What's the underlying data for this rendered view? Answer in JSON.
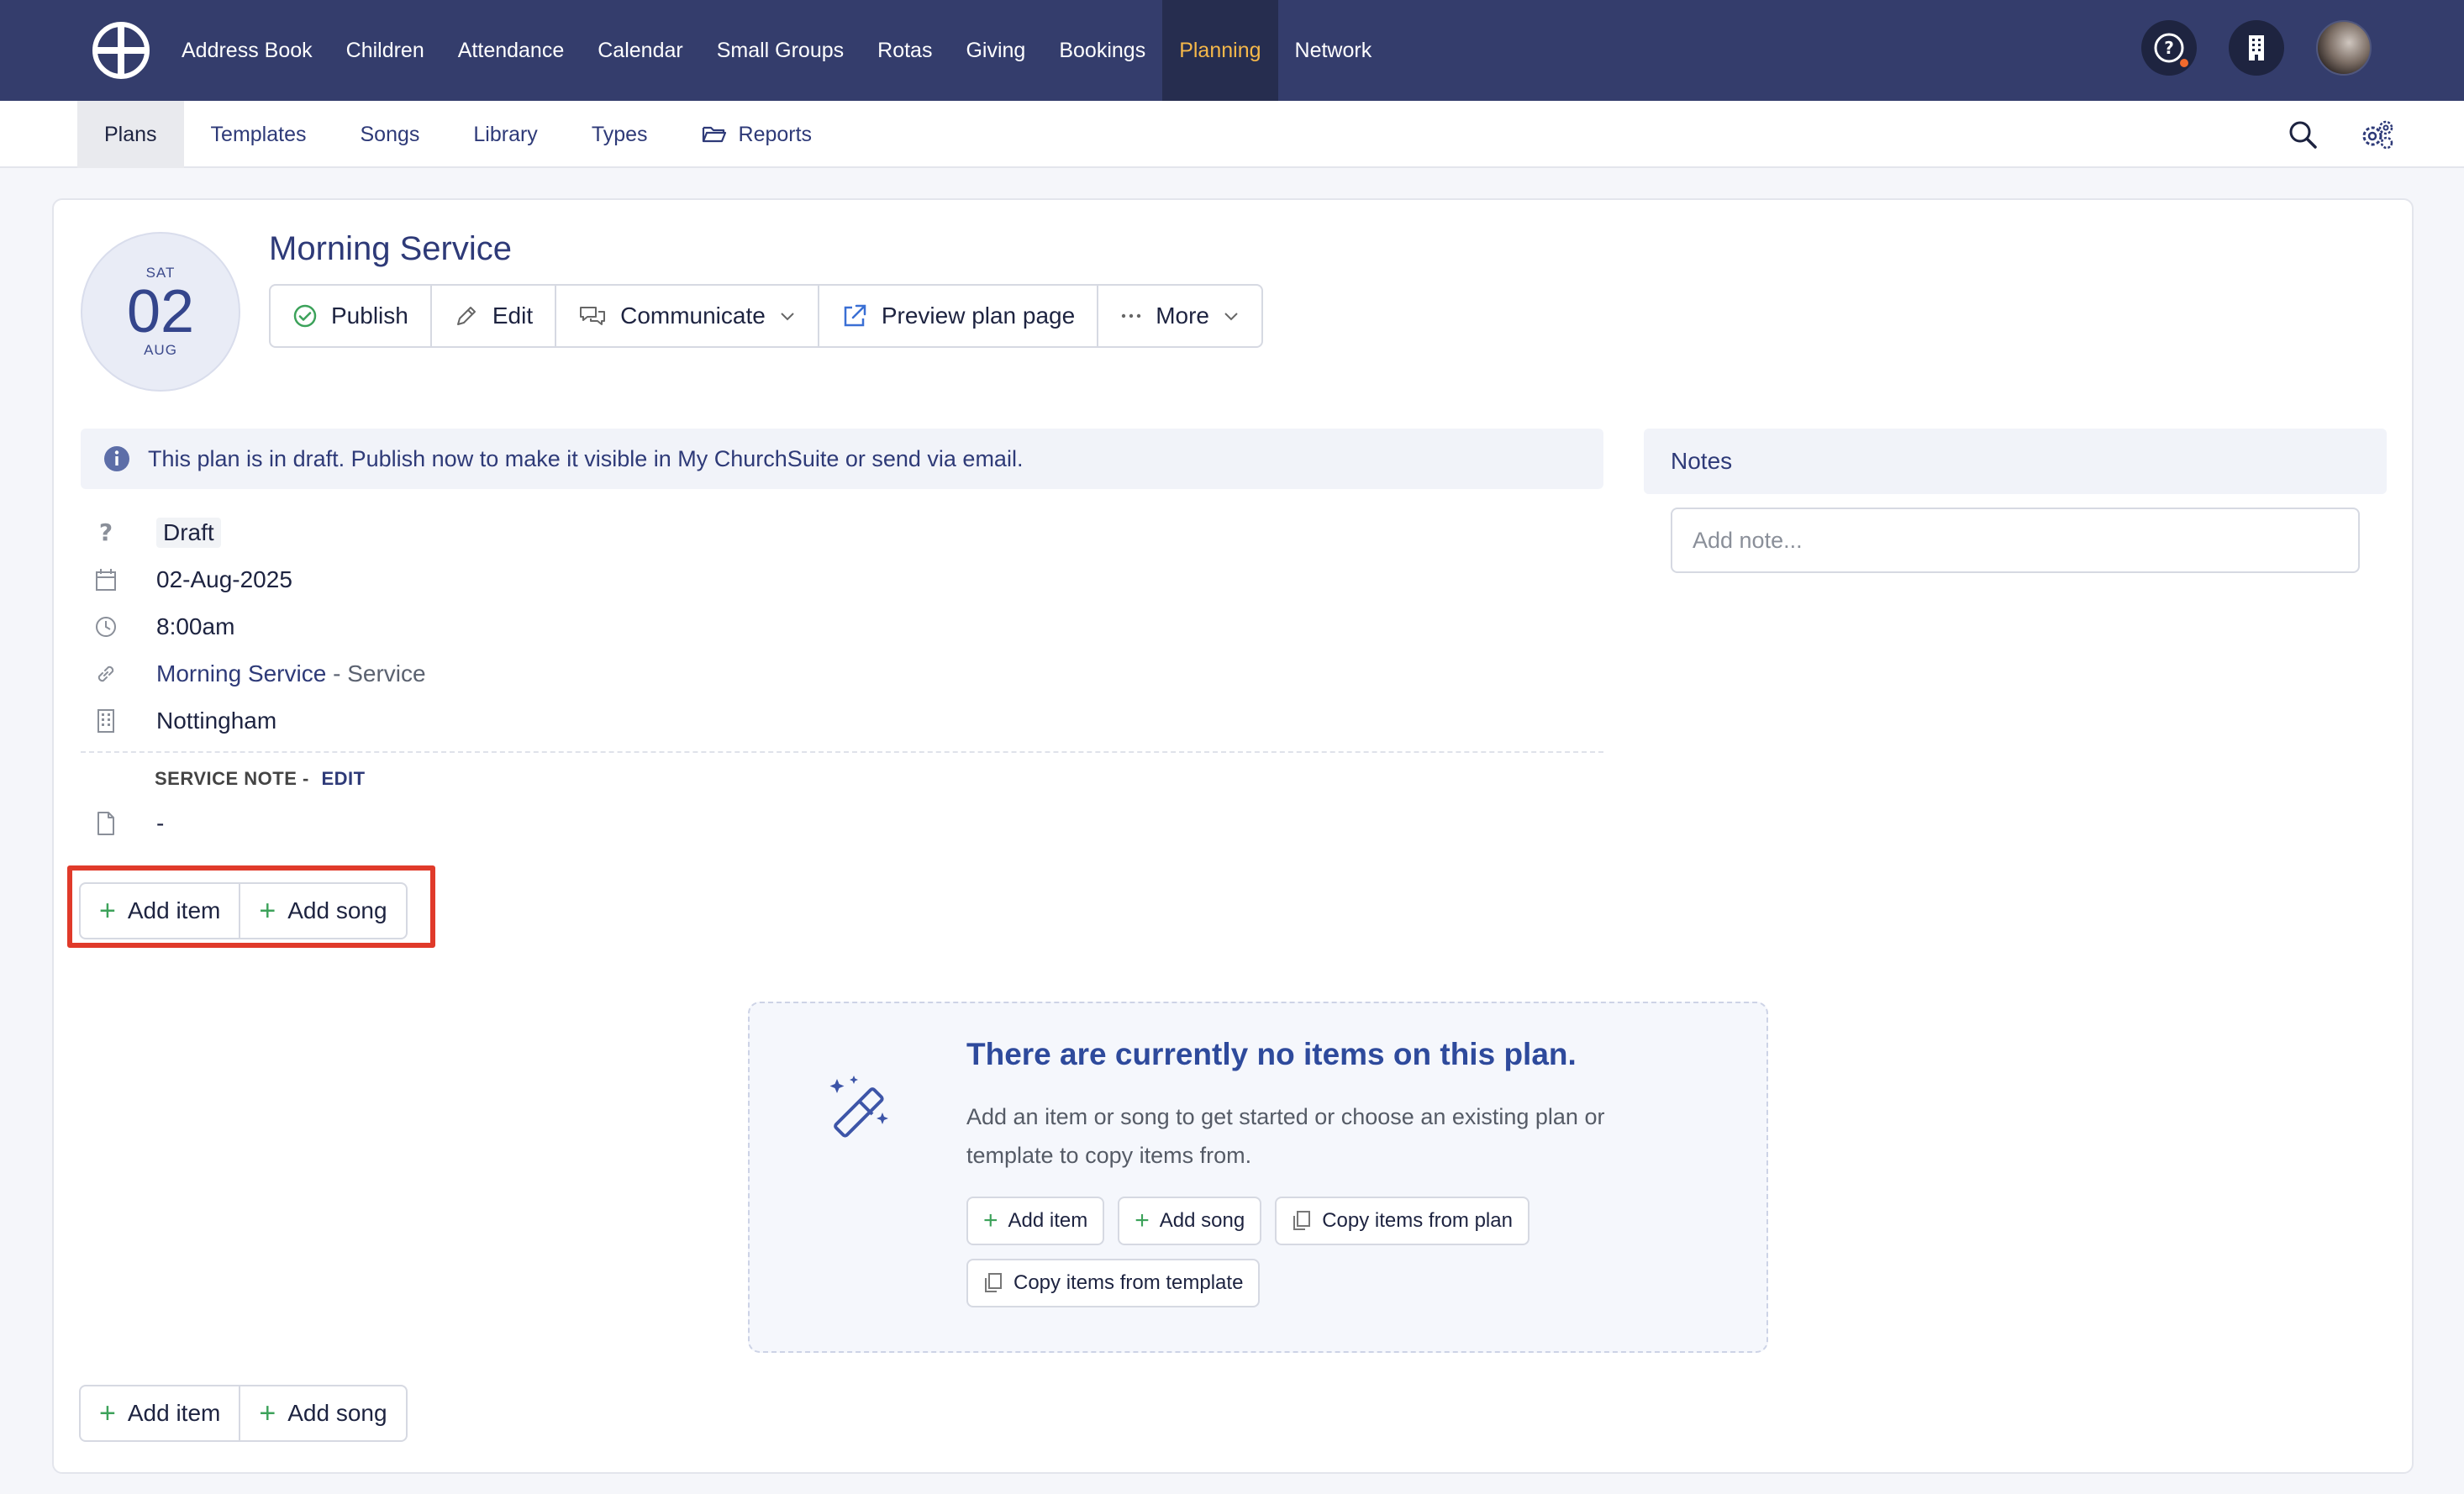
{
  "topnav": {
    "items": [
      {
        "label": "Address Book",
        "active": false
      },
      {
        "label": "Children",
        "active": false
      },
      {
        "label": "Attendance",
        "active": false
      },
      {
        "label": "Calendar",
        "active": false
      },
      {
        "label": "Small Groups",
        "active": false
      },
      {
        "label": "Rotas",
        "active": false
      },
      {
        "label": "Giving",
        "active": false
      },
      {
        "label": "Bookings",
        "active": false
      },
      {
        "label": "Planning",
        "active": true
      },
      {
        "label": "Network",
        "active": false
      }
    ],
    "active_color": "#f5b84a",
    "background_color": "#343d6c"
  },
  "subnav": {
    "tabs": [
      {
        "label": "Plans",
        "active": true
      },
      {
        "label": "Templates",
        "active": false
      },
      {
        "label": "Songs",
        "active": false
      },
      {
        "label": "Library",
        "active": false
      },
      {
        "label": "Types",
        "active": false
      },
      {
        "label": "Reports",
        "active": false,
        "icon": "folder-open-icon"
      }
    ]
  },
  "plan": {
    "date": {
      "dow": "SAT",
      "day": "02",
      "month": "AUG"
    },
    "title": "Morning Service",
    "actions": {
      "publish": "Publish",
      "edit": "Edit",
      "communicate": "Communicate",
      "preview": "Preview plan page",
      "more": "More"
    },
    "banner": "This plan is in draft. Publish now to make it visible in My ChurchSuite or send via email.",
    "status": "Draft",
    "date_text": "02-Aug-2025",
    "time": "8:00am",
    "service_link": "Morning Service",
    "service_suffix": "- Service",
    "site": "Nottingham",
    "service_note_label": "SERVICE NOTE -",
    "service_note_edit": "EDIT",
    "service_note_value": "-"
  },
  "buttons": {
    "add_item": "Add item",
    "add_song": "Add song"
  },
  "empty_state": {
    "title": "There are currently no items on this plan.",
    "description": "Add an item or song to get started or choose an existing plan or template to copy items from.",
    "add_item": "Add item",
    "add_song": "Add song",
    "copy_plan": "Copy items from plan",
    "copy_template": "Copy items from template"
  },
  "notes": {
    "heading": "Notes",
    "placeholder": "Add note..."
  },
  "colors": {
    "accent": "#2e3a78",
    "plus_green": "#3ca25a",
    "highlight_red": "#e03a2a"
  }
}
